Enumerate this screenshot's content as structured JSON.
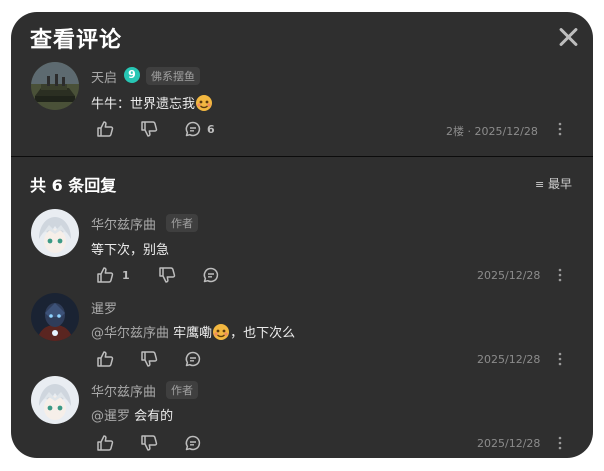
{
  "dialog": {
    "title": "查看评论"
  },
  "main_comment": {
    "author": "天启",
    "level": "9",
    "badge": "佛系摆鱼",
    "text": "牛牛：世界遗忘我",
    "reply_count": "6",
    "meta": "2楼 · 2025/12/28"
  },
  "replies_header": {
    "title": "共 6 条回复",
    "sort_label": "最早"
  },
  "replies": [
    {
      "author": "华尔兹序曲",
      "tag": "作者",
      "text": "等下次，别急",
      "like_count": "1",
      "date": "2025/12/28"
    },
    {
      "author": "暹罗",
      "mention": "@华尔兹序曲",
      "text_a": "牢鹰嘞",
      "text_b": "，也下次么",
      "date": "2025/12/28"
    },
    {
      "author": "华尔兹序曲",
      "tag": "作者",
      "mention": "@暹罗",
      "text": "会有的",
      "date": "2025/12/28"
    }
  ],
  "colors": {
    "panel": "#2f2f2f",
    "accent_level": "#27c6b4"
  }
}
